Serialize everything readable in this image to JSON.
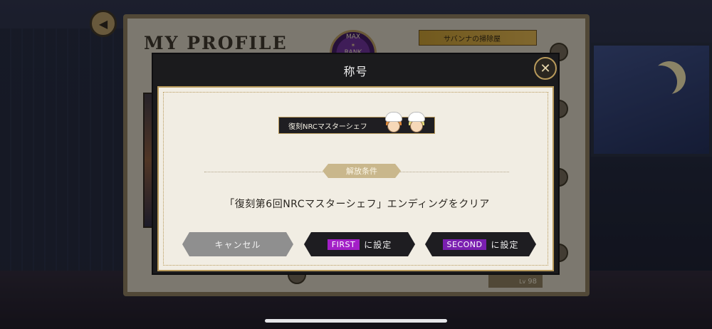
{
  "background": {
    "profile_title": "MY PROFILE",
    "rank_badge": {
      "top": "MAX",
      "bottom": "RANK"
    },
    "dorm_tag": "サバンナの掃除屋",
    "level": {
      "prefix": "Lv",
      "value": "98"
    }
  },
  "modal": {
    "title": "称号",
    "title_plate": "復刻NRCマスターシェフ",
    "condition_label": "解放条件",
    "condition_text": "「復刻第6回NRCマスターシェフ」エンディングをクリア",
    "buttons": {
      "cancel": "キャンセル",
      "first_tag": "FIRST",
      "second_tag": "SECOND",
      "set_suffix": "に設定"
    }
  },
  "colors": {
    "accent_gold": "#b89a5b",
    "slot_purple": "#a31fc7",
    "modal_dark": "#1b1b1d",
    "paper": "#f1ede3"
  },
  "icons": [
    "back-icon",
    "close-icon",
    "chef-avatar-icon"
  ]
}
